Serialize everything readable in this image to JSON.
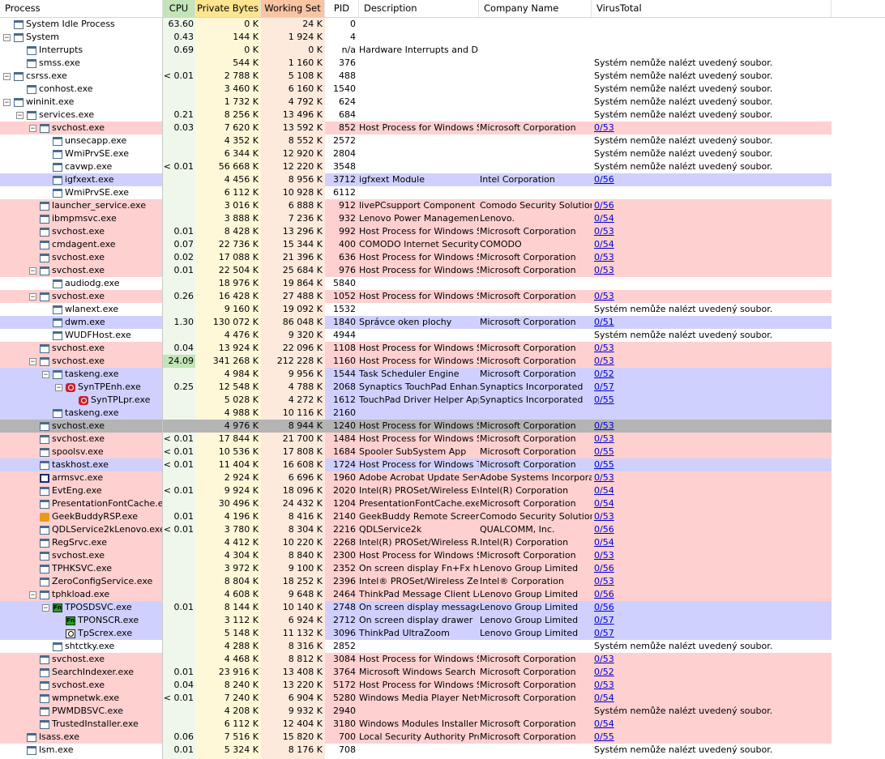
{
  "columns": {
    "process": "Process",
    "cpu": "CPU",
    "private_bytes": "Private Bytes",
    "working_set": "Working Set",
    "pid": "PID",
    "description": "Description",
    "company": "Company Name",
    "virustotal": "VirusTotal"
  },
  "colors": {
    "cpu_header": "#c2e4b8",
    "private_header": "#ffe58f",
    "working_header": "#f7c4a4",
    "cpu_col": "#eef7ea",
    "private_col": "#fff8d8",
    "working_col": "#fdeadd",
    "service_row": "#ffd0d0",
    "own_row": "#d0d0ff",
    "selected_row": "#b4b4b4",
    "link": "#0000cc"
  },
  "rows": [
    {
      "name": "System Idle Process",
      "indent": 0,
      "box": "",
      "icon": "window",
      "cpu": "63.60",
      "priv": "0 K",
      "ws": "24 K",
      "pid": "0",
      "desc": "",
      "company": "",
      "vt": "",
      "style": "normal",
      "cpu_hl": false
    },
    {
      "name": "System",
      "indent": 0,
      "box": "-",
      "icon": "window",
      "cpu": "0.43",
      "priv": "144 K",
      "ws": "1 924 K",
      "pid": "4",
      "desc": "",
      "company": "",
      "vt": "",
      "style": "normal",
      "cpu_hl": false
    },
    {
      "name": "Interrupts",
      "indent": 1,
      "box": "",
      "icon": "window",
      "cpu": "0.69",
      "priv": "0 K",
      "ws": "0 K",
      "pid": "n/a",
      "desc": "Hardware Interrupts and DPCs",
      "company": "",
      "vt": "",
      "style": "normal",
      "cpu_hl": false
    },
    {
      "name": "smss.exe",
      "indent": 1,
      "box": "",
      "icon": "window",
      "cpu": "",
      "priv": "544 K",
      "ws": "1 160 K",
      "pid": "376",
      "desc": "",
      "company": "",
      "vt": "Systém nemůže nalézt uvedený soubor.",
      "style": "normal",
      "cpu_hl": false
    },
    {
      "name": "csrss.exe",
      "indent": 0,
      "box": "-",
      "icon": "window",
      "cpu": "< 0.01",
      "priv": "2 788 K",
      "ws": "5 108 K",
      "pid": "488",
      "desc": "",
      "company": "",
      "vt": "Systém nemůže nalézt uvedený soubor.",
      "style": "normal",
      "cpu_hl": false
    },
    {
      "name": "conhost.exe",
      "indent": 1,
      "box": "",
      "icon": "window",
      "cpu": "",
      "priv": "3 460 K",
      "ws": "6 160 K",
      "pid": "1540",
      "desc": "",
      "company": "",
      "vt": "Systém nemůže nalézt uvedený soubor.",
      "style": "normal",
      "cpu_hl": false
    },
    {
      "name": "wininit.exe",
      "indent": 0,
      "box": "-",
      "icon": "window",
      "cpu": "",
      "priv": "1 732 K",
      "ws": "4 792 K",
      "pid": "624",
      "desc": "",
      "company": "",
      "vt": "Systém nemůže nalézt uvedený soubor.",
      "style": "normal",
      "cpu_hl": false
    },
    {
      "name": "services.exe",
      "indent": 1,
      "box": "-",
      "icon": "window",
      "cpu": "0.21",
      "priv": "8 256 K",
      "ws": "13 496 K",
      "pid": "684",
      "desc": "",
      "company": "",
      "vt": "Systém nemůže nalézt uvedený soubor.",
      "style": "normal",
      "cpu_hl": false
    },
    {
      "name": "svchost.exe",
      "indent": 2,
      "box": "-",
      "icon": "window",
      "cpu": "0.03",
      "priv": "7 620 K",
      "ws": "13 592 K",
      "pid": "852",
      "desc": "Host Process for Windows S...",
      "company": "Microsoft Corporation",
      "vt": "0/53",
      "style": "service",
      "cpu_hl": false
    },
    {
      "name": "unsecapp.exe",
      "indent": 3,
      "box": "",
      "icon": "window",
      "cpu": "",
      "priv": "4 352 K",
      "ws": "8 552 K",
      "pid": "2572",
      "desc": "",
      "company": "",
      "vt": "Systém nemůže nalézt uvedený soubor.",
      "style": "normal",
      "cpu_hl": false
    },
    {
      "name": "WmiPrvSE.exe",
      "indent": 3,
      "box": "",
      "icon": "window",
      "cpu": "",
      "priv": "6 344 K",
      "ws": "12 920 K",
      "pid": "2804",
      "desc": "",
      "company": "",
      "vt": "Systém nemůže nalézt uvedený soubor.",
      "style": "normal",
      "cpu_hl": false
    },
    {
      "name": "cavwp.exe",
      "indent": 3,
      "box": "",
      "icon": "window",
      "cpu": "< 0.01",
      "priv": "56 668 K",
      "ws": "12 220 K",
      "pid": "3548",
      "desc": "",
      "company": "",
      "vt": "Systém nemůže nalézt uvedený soubor.",
      "style": "normal",
      "cpu_hl": false
    },
    {
      "name": "igfxext.exe",
      "indent": 3,
      "box": "",
      "icon": "window",
      "cpu": "",
      "priv": "4 456 K",
      "ws": "8 956 K",
      "pid": "3712",
      "desc": "igfxext Module",
      "company": "Intel Corporation",
      "vt": "0/56",
      "style": "own",
      "cpu_hl": false
    },
    {
      "name": "WmiPrvSE.exe",
      "indent": 3,
      "box": "",
      "icon": "window",
      "cpu": "",
      "priv": "6 112 K",
      "ws": "10 928 K",
      "pid": "6112",
      "desc": "",
      "company": "",
      "vt": "",
      "style": "normal",
      "cpu_hl": false
    },
    {
      "name": "launcher_service.exe",
      "indent": 2,
      "box": "",
      "icon": "window",
      "cpu": "",
      "priv": "3 016 K",
      "ws": "6 888 K",
      "pid": "912",
      "desc": "livePCsupport Component",
      "company": "Comodo Security Solutions...",
      "vt": "0/56",
      "style": "service",
      "cpu_hl": false
    },
    {
      "name": "ibmpmsvc.exe",
      "indent": 2,
      "box": "",
      "icon": "window",
      "cpu": "",
      "priv": "3 888 K",
      "ws": "7 236 K",
      "pid": "932",
      "desc": "Lenovo Power Management ...",
      "company": "Lenovo.",
      "vt": "0/54",
      "style": "service",
      "cpu_hl": false
    },
    {
      "name": "svchost.exe",
      "indent": 2,
      "box": "",
      "icon": "window",
      "cpu": "0.01",
      "priv": "8 428 K",
      "ws": "13 296 K",
      "pid": "992",
      "desc": "Host Process for Windows S...",
      "company": "Microsoft Corporation",
      "vt": "0/53",
      "style": "service",
      "cpu_hl": false
    },
    {
      "name": "cmdagent.exe",
      "indent": 2,
      "box": "",
      "icon": "window",
      "cpu": "0.07",
      "priv": "22 736 K",
      "ws": "15 344 K",
      "pid": "400",
      "desc": "COMODO Internet Security",
      "company": "COMODO",
      "vt": "0/54",
      "style": "service",
      "cpu_hl": false
    },
    {
      "name": "svchost.exe",
      "indent": 2,
      "box": "",
      "icon": "window",
      "cpu": "0.02",
      "priv": "17 088 K",
      "ws": "21 396 K",
      "pid": "636",
      "desc": "Host Process for Windows S...",
      "company": "Microsoft Corporation",
      "vt": "0/53",
      "style": "service",
      "cpu_hl": false
    },
    {
      "name": "svchost.exe",
      "indent": 2,
      "box": "-",
      "icon": "window",
      "cpu": "0.01",
      "priv": "22 504 K",
      "ws": "25 684 K",
      "pid": "976",
      "desc": "Host Process for Windows S...",
      "company": "Microsoft Corporation",
      "vt": "0/53",
      "style": "service",
      "cpu_hl": false
    },
    {
      "name": "audiodg.exe",
      "indent": 3,
      "box": "",
      "icon": "window",
      "cpu": "",
      "priv": "18 976 K",
      "ws": "19 864 K",
      "pid": "5840",
      "desc": "",
      "company": "",
      "vt": "",
      "style": "normal",
      "cpu_hl": false
    },
    {
      "name": "svchost.exe",
      "indent": 2,
      "box": "-",
      "icon": "window",
      "cpu": "0.26",
      "priv": "16 428 K",
      "ws": "27 488 K",
      "pid": "1052",
      "desc": "Host Process for Windows S...",
      "company": "Microsoft Corporation",
      "vt": "0/53",
      "style": "service",
      "cpu_hl": false
    },
    {
      "name": "wlanext.exe",
      "indent": 3,
      "box": "",
      "icon": "window",
      "cpu": "",
      "priv": "9 160 K",
      "ws": "19 092 K",
      "pid": "1532",
      "desc": "",
      "company": "",
      "vt": "Systém nemůže nalézt uvedený soubor.",
      "style": "normal",
      "cpu_hl": false
    },
    {
      "name": "dwm.exe",
      "indent": 3,
      "box": "",
      "icon": "window",
      "cpu": "1.30",
      "priv": "130 072 K",
      "ws": "86 048 K",
      "pid": "1840",
      "desc": "Správce oken plochy",
      "company": "Microsoft Corporation",
      "vt": "0/51",
      "style": "own",
      "cpu_hl": false
    },
    {
      "name": "WUDFHost.exe",
      "indent": 3,
      "box": "",
      "icon": "window",
      "cpu": "",
      "priv": "4 476 K",
      "ws": "9 320 K",
      "pid": "4944",
      "desc": "",
      "company": "",
      "vt": "Systém nemůže nalézt uvedený soubor.",
      "style": "normal",
      "cpu_hl": false
    },
    {
      "name": "svchost.exe",
      "indent": 2,
      "box": "",
      "icon": "window",
      "cpu": "0.04",
      "priv": "13 924 K",
      "ws": "22 096 K",
      "pid": "1108",
      "desc": "Host Process for Windows S...",
      "company": "Microsoft Corporation",
      "vt": "0/53",
      "style": "service",
      "cpu_hl": false
    },
    {
      "name": "svchost.exe",
      "indent": 2,
      "box": "-",
      "icon": "window",
      "cpu": "24.09",
      "priv": "341 268 K",
      "ws": "212 228 K",
      "pid": "1160",
      "desc": "Host Process for Windows S...",
      "company": "Microsoft Corporation",
      "vt": "0/53",
      "style": "service",
      "cpu_hl": true
    },
    {
      "name": "taskeng.exe",
      "indent": 3,
      "box": "-",
      "icon": "window",
      "cpu": "",
      "priv": "4 984 K",
      "ws": "9 956 K",
      "pid": "1544",
      "desc": "Task Scheduler Engine",
      "company": "Microsoft Corporation",
      "vt": "0/52",
      "style": "own",
      "cpu_hl": false
    },
    {
      "name": "SynTPEnh.exe",
      "indent": 4,
      "box": "-",
      "icon": "synaptics",
      "cpu": "0.25",
      "priv": "12 548 K",
      "ws": "4 788 K",
      "pid": "2068",
      "desc": "Synaptics TouchPad Enhan...",
      "company": "Synaptics Incorporated",
      "vt": "0/57",
      "style": "own",
      "cpu_hl": false
    },
    {
      "name": "SynTPLpr.exe",
      "indent": 5,
      "box": "",
      "icon": "synaptics",
      "cpu": "",
      "priv": "5 028 K",
      "ws": "4 272 K",
      "pid": "1612",
      "desc": "TouchPad Driver Helper App...",
      "company": "Synaptics Incorporated",
      "vt": "0/55",
      "style": "own",
      "cpu_hl": false
    },
    {
      "name": "taskeng.exe",
      "indent": 3,
      "box": "",
      "icon": "window",
      "cpu": "",
      "priv": "4 988 K",
      "ws": "10 116 K",
      "pid": "2160",
      "desc": "",
      "company": "",
      "vt": "",
      "style": "own",
      "cpu_hl": false
    },
    {
      "name": "svchost.exe",
      "indent": 2,
      "box": "",
      "icon": "window",
      "cpu": "",
      "priv": "4 976 K",
      "ws": "8 944 K",
      "pid": "1240",
      "desc": "Host Process for Windows S...",
      "company": "Microsoft Corporation",
      "vt": "0/53",
      "style": "selected",
      "cpu_hl": false
    },
    {
      "name": "svchost.exe",
      "indent": 2,
      "box": "",
      "icon": "window",
      "cpu": "< 0.01",
      "priv": "17 844 K",
      "ws": "21 700 K",
      "pid": "1484",
      "desc": "Host Process for Windows S...",
      "company": "Microsoft Corporation",
      "vt": "0/53",
      "style": "service",
      "cpu_hl": false
    },
    {
      "name": "spoolsv.exe",
      "indent": 2,
      "box": "",
      "icon": "window",
      "cpu": "< 0.01",
      "priv": "10 536 K",
      "ws": "17 808 K",
      "pid": "1684",
      "desc": "Spooler SubSystem App",
      "company": "Microsoft Corporation",
      "vt": "0/55",
      "style": "service",
      "cpu_hl": false
    },
    {
      "name": "taskhost.exe",
      "indent": 2,
      "box": "",
      "icon": "window",
      "cpu": "< 0.01",
      "priv": "11 404 K",
      "ws": "16 608 K",
      "pid": "1724",
      "desc": "Host Process for Windows T...",
      "company": "Microsoft Corporation",
      "vt": "0/55",
      "style": "own",
      "cpu_hl": false
    },
    {
      "name": "armsvc.exe",
      "indent": 2,
      "box": "",
      "icon": "outline",
      "cpu": "",
      "priv": "2 924 K",
      "ws": "6 696 K",
      "pid": "1960",
      "desc": "Adobe Acrobat Update Servi...",
      "company": "Adobe Systems Incorporated",
      "vt": "0/53",
      "style": "service",
      "cpu_hl": false
    },
    {
      "name": "EvtEng.exe",
      "indent": 2,
      "box": "",
      "icon": "window",
      "cpu": "< 0.01",
      "priv": "9 924 K",
      "ws": "18 096 K",
      "pid": "2020",
      "desc": "Intel(R) PROSet/Wireless Ev...",
      "company": "Intel(R) Corporation",
      "vt": "0/54",
      "style": "service",
      "cpu_hl": false
    },
    {
      "name": "PresentationFontCache.e...",
      "indent": 2,
      "box": "",
      "icon": "window",
      "cpu": "",
      "priv": "30 496 K",
      "ws": "24 432 K",
      "pid": "1204",
      "desc": "PresentationFontCache.exe",
      "company": "Microsoft Corporation",
      "vt": "0/54",
      "style": "service",
      "cpu_hl": false
    },
    {
      "name": "GeekBuddyRSP.exe",
      "indent": 2,
      "box": "",
      "icon": "geek",
      "cpu": "0.01",
      "priv": "4 196 K",
      "ws": "8 416 K",
      "pid": "2140",
      "desc": "GeekBuddy Remote Screen ...",
      "company": "Comodo Security Solutions...",
      "vt": "0/53",
      "style": "service",
      "cpu_hl": false
    },
    {
      "name": "QDLService2kLenovo.exe",
      "indent": 2,
      "box": "",
      "icon": "window",
      "cpu": "< 0.01",
      "priv": "3 780 K",
      "ws": "8 304 K",
      "pid": "2216",
      "desc": "QDLService2k",
      "company": "QUALCOMM, Inc.",
      "vt": "0/56",
      "style": "service",
      "cpu_hl": false
    },
    {
      "name": "RegSrvc.exe",
      "indent": 2,
      "box": "",
      "icon": "window",
      "cpu": "",
      "priv": "4 412 K",
      "ws": "10 220 K",
      "pid": "2268",
      "desc": "Intel(R) PROSet/Wireless R...",
      "company": "Intel(R) Corporation",
      "vt": "0/54",
      "style": "service",
      "cpu_hl": false
    },
    {
      "name": "svchost.exe",
      "indent": 2,
      "box": "",
      "icon": "window",
      "cpu": "",
      "priv": "4 304 K",
      "ws": "8 840 K",
      "pid": "2300",
      "desc": "Host Process for Windows S...",
      "company": "Microsoft Corporation",
      "vt": "0/53",
      "style": "service",
      "cpu_hl": false
    },
    {
      "name": "TPHKSVC.exe",
      "indent": 2,
      "box": "",
      "icon": "window",
      "cpu": "",
      "priv": "3 972 K",
      "ws": "9 100 K",
      "pid": "2352",
      "desc": "On screen display Fn+Fx han...",
      "company": "Lenovo Group Limited",
      "vt": "0/56",
      "style": "service",
      "cpu_hl": false
    },
    {
      "name": "ZeroConfigService.exe",
      "indent": 2,
      "box": "",
      "icon": "window",
      "cpu": "",
      "priv": "8 804 K",
      "ws": "18 252 K",
      "pid": "2396",
      "desc": "Intel® PROSet/Wireless Zer...",
      "company": "Intel® Corporation",
      "vt": "0/53",
      "style": "service",
      "cpu_hl": false
    },
    {
      "name": "tphkload.exe",
      "indent": 2,
      "box": "-",
      "icon": "window",
      "cpu": "",
      "priv": "4 608 K",
      "ws": "9 648 K",
      "pid": "2464",
      "desc": "ThinkPad Message Client Lo...",
      "company": "Lenovo Group Limited",
      "vt": "0/56",
      "style": "service",
      "cpu_hl": false
    },
    {
      "name": "TPOSDSVC.exe",
      "indent": 3,
      "box": "-",
      "icon": "fn",
      "cpu": "0.01",
      "priv": "8 144 K",
      "ws": "10 140 K",
      "pid": "2748",
      "desc": "On screen display message ...",
      "company": "Lenovo Group Limited",
      "vt": "0/56",
      "style": "own",
      "cpu_hl": false
    },
    {
      "name": "TPONSCR.exe",
      "indent": 4,
      "box": "",
      "icon": "fn",
      "cpu": "",
      "priv": "3 112 K",
      "ws": "6 924 K",
      "pid": "2712",
      "desc": "On screen display drawer",
      "company": "Lenovo Group Limited",
      "vt": "0/57",
      "style": "own",
      "cpu_hl": false
    },
    {
      "name": "TpScrex.exe",
      "indent": 4,
      "box": "",
      "icon": "zoom",
      "cpu": "",
      "priv": "5 148 K",
      "ws": "11 132 K",
      "pid": "3096",
      "desc": "ThinkPad UltraZoom",
      "company": "Lenovo Group Limited",
      "vt": "0/57",
      "style": "own",
      "cpu_hl": false
    },
    {
      "name": "shtctky.exe",
      "indent": 3,
      "box": "",
      "icon": "window",
      "cpu": "",
      "priv": "4 288 K",
      "ws": "8 316 K",
      "pid": "2852",
      "desc": "",
      "company": "",
      "vt": "Systém nemůže nalézt uvedený soubor.",
      "style": "normal",
      "cpu_hl": false
    },
    {
      "name": "svchost.exe",
      "indent": 2,
      "box": "",
      "icon": "window",
      "cpu": "",
      "priv": "4 468 K",
      "ws": "8 812 K",
      "pid": "3084",
      "desc": "Host Process for Windows S...",
      "company": "Microsoft Corporation",
      "vt": "0/53",
      "style": "service",
      "cpu_hl": false
    },
    {
      "name": "SearchIndexer.exe",
      "indent": 2,
      "box": "",
      "icon": "window",
      "cpu": "0.01",
      "priv": "23 916 K",
      "ws": "13 408 K",
      "pid": "3764",
      "desc": "Microsoft Windows Search I...",
      "company": "Microsoft Corporation",
      "vt": "0/52",
      "style": "service",
      "cpu_hl": false
    },
    {
      "name": "svchost.exe",
      "indent": 2,
      "box": "",
      "icon": "window",
      "cpu": "0.04",
      "priv": "8 240 K",
      "ws": "13 220 K",
      "pid": "5172",
      "desc": "Host Process for Windows S...",
      "company": "Microsoft Corporation",
      "vt": "0/53",
      "style": "service",
      "cpu_hl": false
    },
    {
      "name": "wmpnetwk.exe",
      "indent": 2,
      "box": "",
      "icon": "window",
      "cpu": "< 0.01",
      "priv": "7 240 K",
      "ws": "6 904 K",
      "pid": "5280",
      "desc": "Windows Media Player Netw...",
      "company": "Microsoft Corporation",
      "vt": "0/54",
      "style": "service",
      "cpu_hl": false
    },
    {
      "name": "PWMDBSVC.exe",
      "indent": 2,
      "box": "",
      "icon": "window",
      "cpu": "",
      "priv": "4 208 K",
      "ws": "9 932 K",
      "pid": "2940",
      "desc": "",
      "company": "",
      "vt": "Systém nemůže nalézt uvedený soubor.",
      "style": "service",
      "cpu_hl": false
    },
    {
      "name": "TrustedInstaller.exe",
      "indent": 2,
      "box": "",
      "icon": "window",
      "cpu": "",
      "priv": "6 112 K",
      "ws": "12 404 K",
      "pid": "3180",
      "desc": "Windows Modules Installer",
      "company": "Microsoft Corporation",
      "vt": "0/54",
      "style": "service",
      "cpu_hl": false
    },
    {
      "name": "lsass.exe",
      "indent": 1,
      "box": "",
      "icon": "window",
      "cpu": "0.06",
      "priv": "7 516 K",
      "ws": "15 820 K",
      "pid": "700",
      "desc": "Local Security Authority Proc...",
      "company": "Microsoft Corporation",
      "vt": "0/55",
      "style": "service",
      "cpu_hl": false
    },
    {
      "name": "lsm.exe",
      "indent": 1,
      "box": "",
      "icon": "window",
      "cpu": "0.01",
      "priv": "5 324 K",
      "ws": "8 176 K",
      "pid": "708",
      "desc": "",
      "company": "",
      "vt": "Systém nemůže nalézt uvedený soubor.",
      "style": "normal",
      "cpu_hl": false
    }
  ]
}
